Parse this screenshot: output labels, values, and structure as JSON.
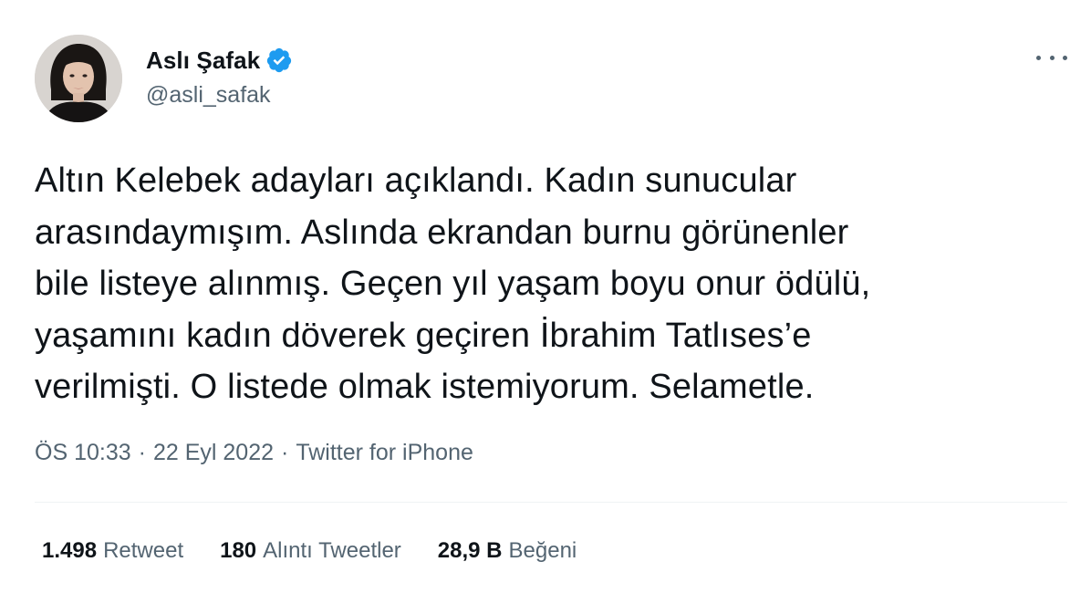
{
  "author": {
    "display_name": "Aslı Şafak",
    "handle": "@asli_safak",
    "verified": true
  },
  "icons": {
    "verified": "verified-badge-icon",
    "more": "more-icon"
  },
  "colors": {
    "text": "#0f1419",
    "secondary": "#536471",
    "verified_blue": "#1d9bf0",
    "divider": "#eff3f4"
  },
  "tweet": {
    "lines": [
      "Altın Kelebek adayları açıklandı. Kadın sunucular",
      "arasındaymışım. Aslında ekrandan burnu görünenler",
      "bile listeye alınmış. Geçen yıl yaşam boyu onur ödülü,",
      "yaşamını kadın döverek geçiren İbrahim Tatlıses’e",
      "verilmişti. O listede olmak istemiyorum. Selametle."
    ],
    "time": "ÖS 10:33",
    "date": "22 Eyl 2022",
    "separator": "·",
    "source": "Twitter for iPhone"
  },
  "stats": {
    "retweets": {
      "count": "1.498",
      "label": "Retweet"
    },
    "quotes": {
      "count": "180",
      "label": "Alıntı Tweetler"
    },
    "likes": {
      "count": "28,9 B",
      "label": "Beğeni"
    }
  }
}
